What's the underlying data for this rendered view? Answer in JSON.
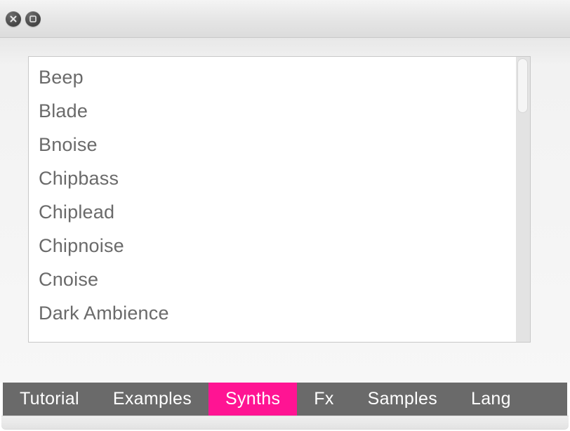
{
  "titlebar": {
    "close_icon": "close",
    "maximize_icon": "maximize"
  },
  "list": {
    "items": [
      "Beep",
      "Blade",
      "Bnoise",
      "Chipbass",
      "Chiplead",
      "Chipnoise",
      "Cnoise",
      "Dark Ambience"
    ]
  },
  "tabs": {
    "items": [
      {
        "label": "Tutorial",
        "active": false
      },
      {
        "label": "Examples",
        "active": false
      },
      {
        "label": "Synths",
        "active": true
      },
      {
        "label": "Fx",
        "active": false
      },
      {
        "label": "Samples",
        "active": false
      },
      {
        "label": "Lang",
        "active": false
      }
    ]
  },
  "colors": {
    "accent": "#ff1493",
    "tab_bg": "#6a6a6a",
    "text_muted": "#6a6a6a"
  }
}
